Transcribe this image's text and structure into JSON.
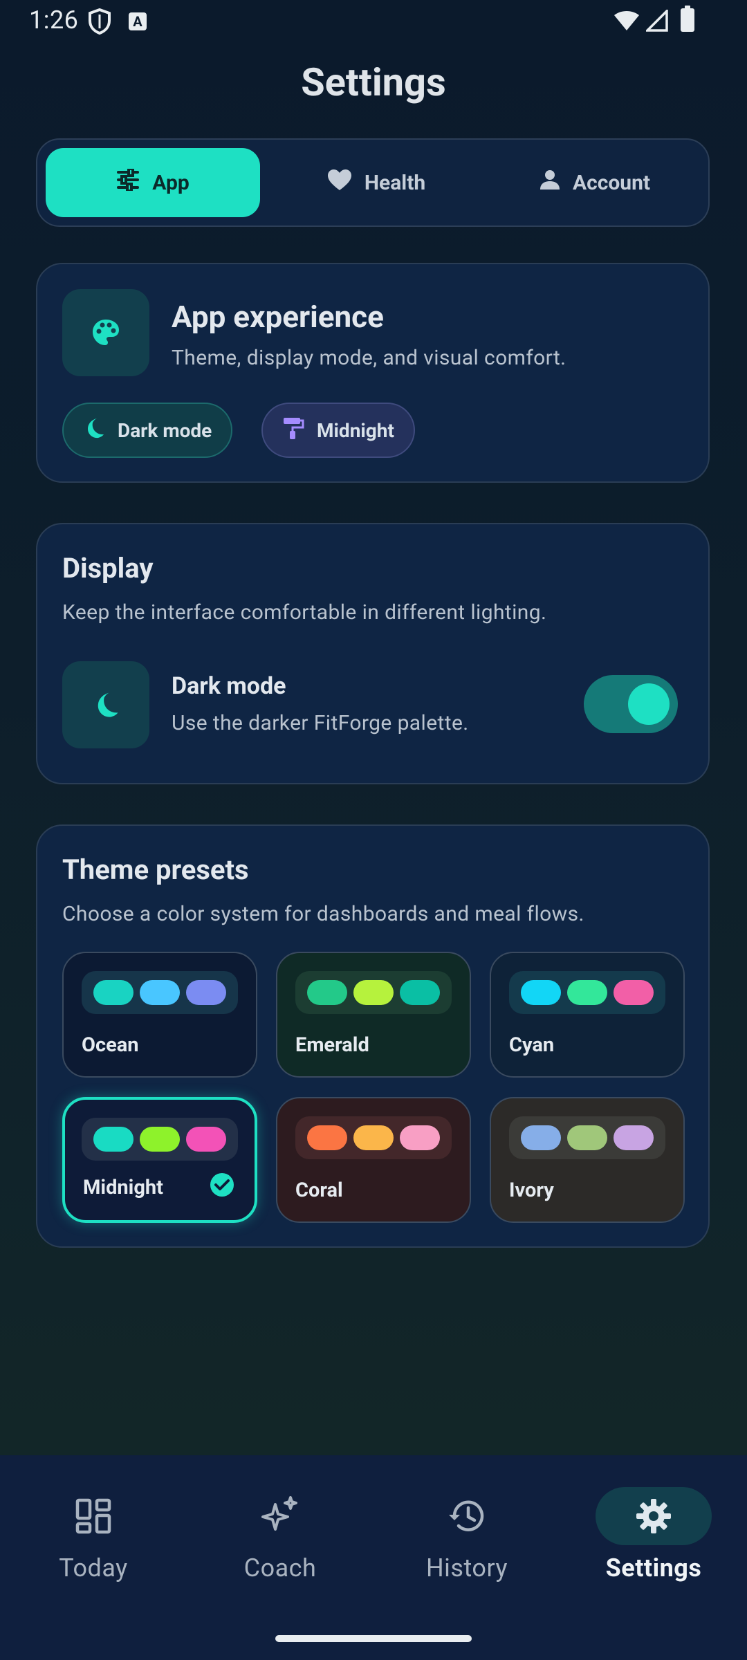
{
  "status": {
    "time": "1:26"
  },
  "page": {
    "title": "Settings"
  },
  "tabs": [
    {
      "label": "App",
      "icon": "sliders-icon",
      "active": true
    },
    {
      "label": "Health",
      "icon": "heart-icon",
      "active": false
    },
    {
      "label": "Account",
      "icon": "person-icon",
      "active": false
    }
  ],
  "app_card": {
    "title": "App experience",
    "subtitle": "Theme, display mode, and visual comfort.",
    "chips": [
      {
        "label": "Dark mode",
        "icon": "moon-icon"
      },
      {
        "label": "Midnight",
        "icon": "paint-roller-icon"
      }
    ]
  },
  "display_card": {
    "title": "Display",
    "subtitle": "Keep the interface comfortable in different lighting.",
    "row_title": "Dark mode",
    "row_subtitle": "Use the darker FitForge palette.",
    "toggle_on": true
  },
  "themes_card": {
    "title": "Theme presets",
    "subtitle": "Choose a color system for dashboards and meal flows.",
    "presets": [
      {
        "name": "Ocean",
        "bg": "#0c1a33",
        "swatch_bg": "#16354a",
        "colors": [
          "#19d3c2",
          "#49c6ff",
          "#7b8cf2"
        ],
        "selected": false
      },
      {
        "name": "Emerald",
        "bg": "#0f2a26",
        "swatch_bg": "#1c3d32",
        "colors": [
          "#23c989",
          "#b6f23d",
          "#0abfa4"
        ],
        "selected": false
      },
      {
        "name": "Cyan",
        "bg": "#0e2238",
        "swatch_bg": "#143a4c",
        "colors": [
          "#12d6f6",
          "#33e79a",
          "#f25fa7"
        ],
        "selected": false
      },
      {
        "name": "Midnight",
        "bg": "#0e1b38",
        "swatch_bg": "#233048",
        "colors": [
          "#19dbc3",
          "#8ef22b",
          "#f352b7"
        ],
        "selected": true
      },
      {
        "name": "Coral",
        "bg": "#2d1b1f",
        "swatch_bg": "#43272a",
        "colors": [
          "#fb7543",
          "#fbb64a",
          "#f89fc4"
        ],
        "selected": false
      },
      {
        "name": "Ivory",
        "bg": "#2c2a28",
        "swatch_bg": "#3b3b38",
        "colors": [
          "#86aee8",
          "#a0c77a",
          "#c8a4e3"
        ],
        "selected": false
      }
    ]
  },
  "nav": [
    {
      "label": "Today",
      "icon": "dashboard-icon",
      "active": false
    },
    {
      "label": "Coach",
      "icon": "sparkle-icon",
      "active": false
    },
    {
      "label": "History",
      "icon": "history-icon",
      "active": false
    },
    {
      "label": "Settings",
      "icon": "gear-icon",
      "active": true
    }
  ]
}
